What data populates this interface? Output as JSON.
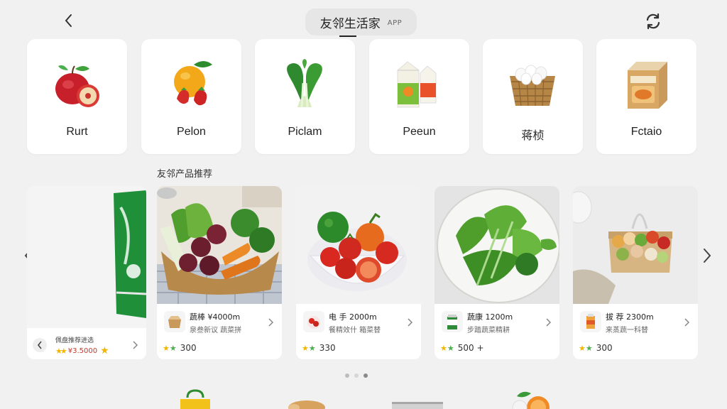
{
  "header": {
    "title": "友邻生活家",
    "badge": "APP",
    "back_icon": "chevron-left-icon",
    "refresh_icon": "refresh-icon"
  },
  "categories": [
    {
      "label": "Rurt",
      "icon": "apple-icon"
    },
    {
      "label": "Pelon",
      "icon": "orange-strawberry-icon"
    },
    {
      "label": "Piclam",
      "icon": "bok-choy-icon"
    },
    {
      "label": "Peeun",
      "icon": "milk-carton-icon"
    },
    {
      "label": "蒋桢",
      "icon": "egg-basket-icon"
    },
    {
      "label": "Fctaio",
      "icon": "food-box-icon"
    }
  ],
  "section_title": "友邻产品推荐",
  "partial_card": {
    "name": "佩盘推荐进选",
    "price": "¥3.5000"
  },
  "products": [
    {
      "name": "蔬棒 ¥4000m",
      "desc": "泉叁新议 蔬菜拼",
      "rating": "300",
      "photo": "vegetable-basket"
    },
    {
      "name": "电 手 2000m",
      "desc": "餐精效什 箱菜替",
      "rating": "330",
      "photo": "tomato-bowl"
    },
    {
      "name": "蔬康 1200m",
      "desc": "步踏蔬菜精耕",
      "rating": "500 +",
      "photo": "leafy-greens-plate"
    },
    {
      "name": "拔 荐 2300m",
      "desc": "来蒸蔬一科替",
      "rating": "300",
      "photo": "produce-box"
    }
  ],
  "pagination": {
    "count": 3,
    "active": 2
  },
  "colors": {
    "background": "#f1f1f1",
    "card": "#ffffff",
    "star": "#f1b600",
    "green_bag": "#1f8f3a"
  }
}
